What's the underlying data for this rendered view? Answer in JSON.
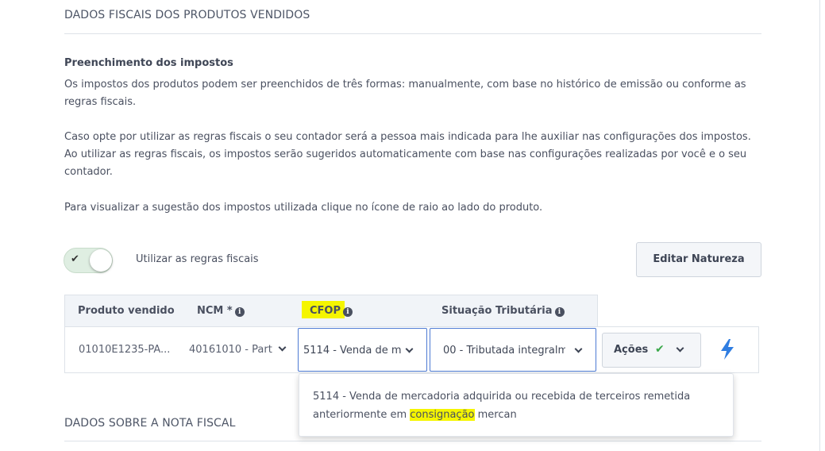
{
  "sections": {
    "produtos_title": "DADOS FISCAIS DOS PRODUTOS VENDIDOS",
    "nota_title": "DADOS SOBRE A NOTA FISCAL"
  },
  "info": {
    "heading": "Preenchimento dos impostos",
    "p1": "Os impostos dos produtos podem ser preenchidos de três formas: manualmente, com base no histórico de emissão ou conforme as regras fiscais.",
    "p2": "Caso opte por utilizar as regras fiscais o seu contador será a pessoa mais indicada para lhe auxiliar nas configurações dos impostos. Ao utilizar as regras fiscais, os impostos serão sugeridos automaticamente com base nas configurações realizadas por você e o seu contador.",
    "p3": "Para visualizar a sugestão dos impostos utilizada clique no ícone de raio ao lado do produto."
  },
  "toggle": {
    "label": "Utilizar as regras fiscais",
    "checked": true
  },
  "buttons": {
    "editar_natureza": "Editar Natureza",
    "acoes": "Ações"
  },
  "table": {
    "headers": {
      "produto": "Produto vendido",
      "ncm": "NCM *",
      "cfop": "CFOP",
      "situacao": "Situação Tributária"
    },
    "row": {
      "produto": "01010E1235-PA...",
      "ncm": "40161010 - Part",
      "cfop": "5114 - Venda de m",
      "situacao": "00 - Tributada integralm"
    }
  },
  "dropdown": {
    "option_before": "5114 - Venda de mercadoria adquirida ou recebida de terceiros remetida anteriormente em ",
    "option_highlight": "consignação",
    "option_after": " mercan"
  },
  "colors": {
    "highlight": "#f5f500",
    "focus_border": "#4e7bd4",
    "check_green": "#3aa84a",
    "bolt_blue": "#2f7de1",
    "toggle_bg": "#dfeee2"
  },
  "icons": {
    "info": "info-icon",
    "chevron": "chevron-down-icon",
    "check": "check-icon",
    "bolt": "lightning-bolt-icon"
  }
}
